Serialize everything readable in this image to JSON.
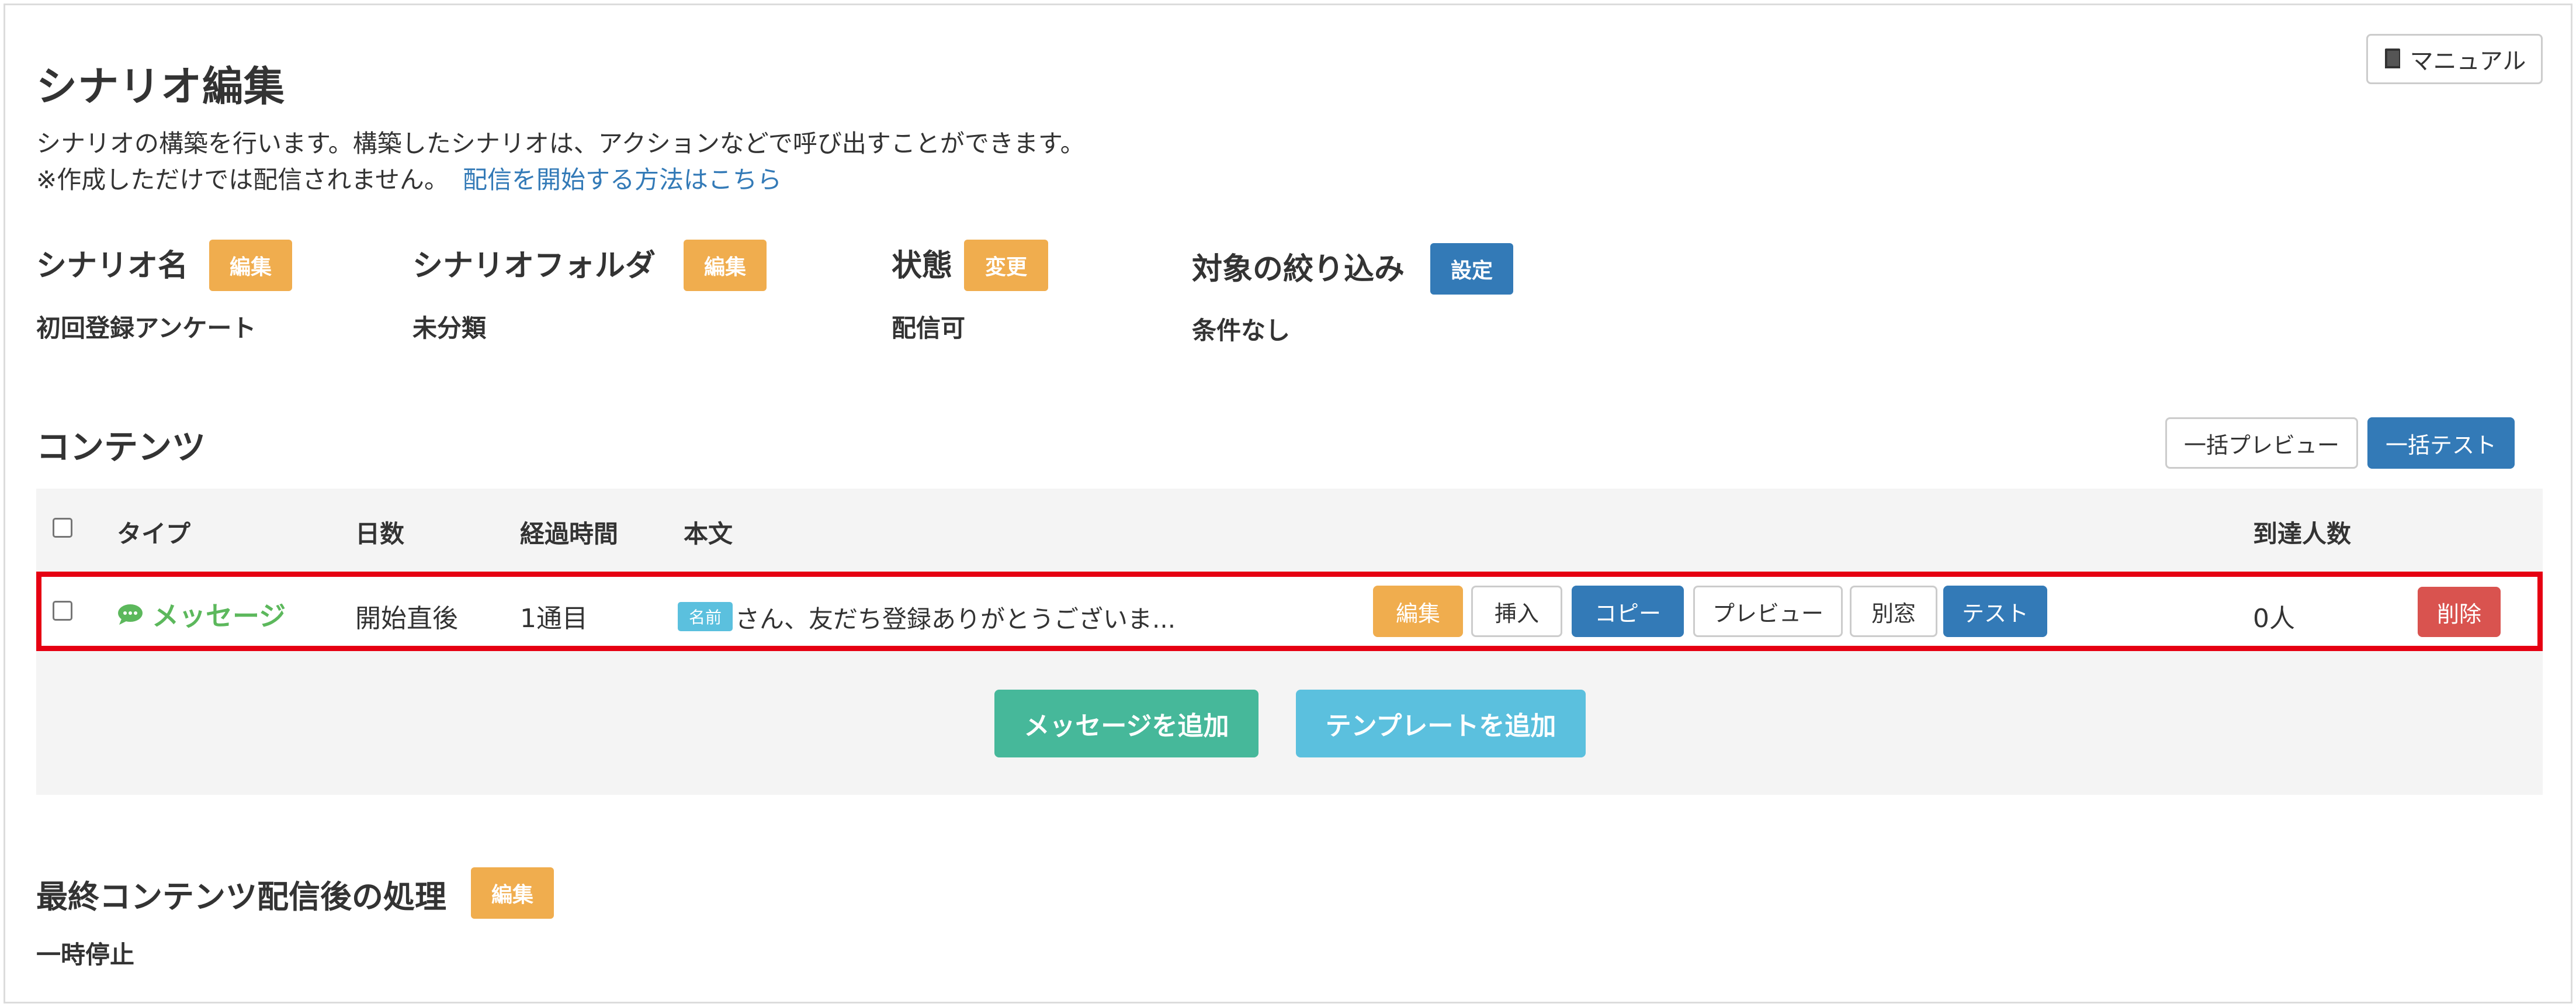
{
  "header": {
    "title": "シナリオ編集",
    "manual_label": "マニュアル",
    "description_line1": "シナリオの構築を行います。構築したシナリオは、アクションなどで呼び出すことができます。",
    "description_line2": "※作成しただけでは配信されません。",
    "how_to_link": "配信を開始する方法はこちら"
  },
  "fields": {
    "scenario_name": {
      "label": "シナリオ名",
      "button": "編集",
      "value": "初回登録アンケート"
    },
    "folder": {
      "label": "シナリオフォルダ",
      "button": "編集",
      "value": "未分類"
    },
    "status": {
      "label": "状態",
      "button": "変更",
      "value": "配信可"
    },
    "filter": {
      "label": "対象の絞り込み",
      "button": "設定",
      "value": "条件なし"
    }
  },
  "contents": {
    "title": "コンテンツ",
    "bulk_preview": "一括プレビュー",
    "bulk_test": "一括テスト",
    "columns": {
      "type": "タイプ",
      "days": "日数",
      "elapsed": "経過時間",
      "body": "本文",
      "reach": "到達人数"
    },
    "row": {
      "type": "メッセージ",
      "days": "開始直後",
      "elapsed": "1通目",
      "name_tag": "名前",
      "body": "さん、友だち登録ありがとうございま...",
      "actions": {
        "edit": "編集",
        "insert": "挿入",
        "copy": "コピー",
        "preview": "プレビュー",
        "window": "別窓",
        "test": "テスト"
      },
      "reach": "0人",
      "delete": "削除"
    },
    "add_message": "メッセージを追加",
    "add_template": "テンプレートを追加"
  },
  "final": {
    "title": "最終コンテンツ配信後の処理",
    "button": "編集",
    "value": "一時停止"
  },
  "colors": {
    "warning": "#f0ad4e",
    "primary": "#337ab7",
    "danger": "#d9534f",
    "success_text": "#5cb85c",
    "highlight_border": "#e60012"
  }
}
